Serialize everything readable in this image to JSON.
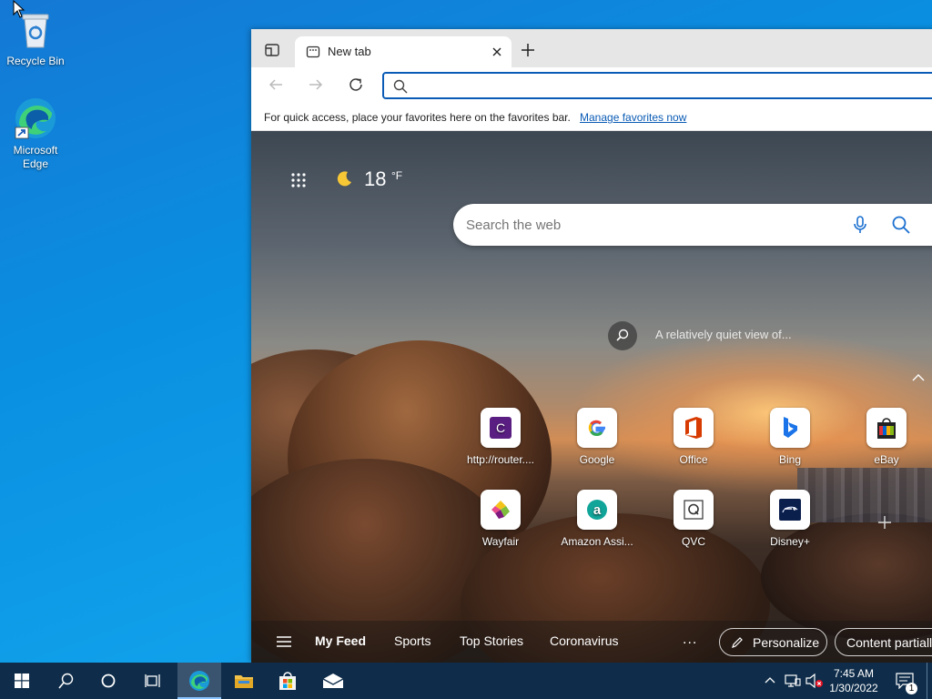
{
  "desktop": {
    "icons": [
      {
        "label": "Recycle Bin"
      },
      {
        "label": "Microsoft Edge"
      }
    ]
  },
  "browser": {
    "tab": {
      "title": "New tab"
    },
    "address_bar": {
      "value": "",
      "placeholder": ""
    },
    "favorites_bar": {
      "message": "For quick access, place your favorites here on the favorites bar.",
      "link": "Manage favorites now"
    },
    "new_tab_page": {
      "weather": {
        "temperature": "18",
        "unit": "°F"
      },
      "search": {
        "placeholder": "Search the web"
      },
      "image_caption": "A relatively quiet view of...",
      "quick_links": [
        {
          "label": "http://router....",
          "icon": "router-c-icon",
          "color": "#5a1e82"
        },
        {
          "label": "Google",
          "icon": "google-icon"
        },
        {
          "label": "Office",
          "icon": "office-icon",
          "color": "#d83b01"
        },
        {
          "label": "Bing",
          "icon": "bing-icon",
          "color": "#1a73e8"
        },
        {
          "label": "eBay",
          "icon": "ebay-icon"
        },
        {
          "label": "Wayfair",
          "icon": "wayfair-icon",
          "color": "#7f187f"
        },
        {
          "label": "Amazon Assi...",
          "icon": "amazon-assistant-icon",
          "color": "#11a59a"
        },
        {
          "label": "QVC",
          "icon": "qvc-icon"
        },
        {
          "label": "Disney+",
          "icon": "disney-plus-icon",
          "color": "#0b1f4d"
        }
      ],
      "feed_tabs": [
        "My Feed",
        "Sports",
        "Top Stories",
        "Coronavirus"
      ],
      "more": "...",
      "personalize": "Personalize",
      "content_button": "Content partiall"
    }
  },
  "taskbar": {
    "clock": {
      "time": "7:45 AM",
      "date": "1/30/2022"
    },
    "notification_count": "1"
  },
  "colors": {
    "desktop": "#0a8fe0",
    "taskbar": "#0f2d4a",
    "link": "#0a5bb5",
    "address_focus": "#0a5bb5"
  }
}
